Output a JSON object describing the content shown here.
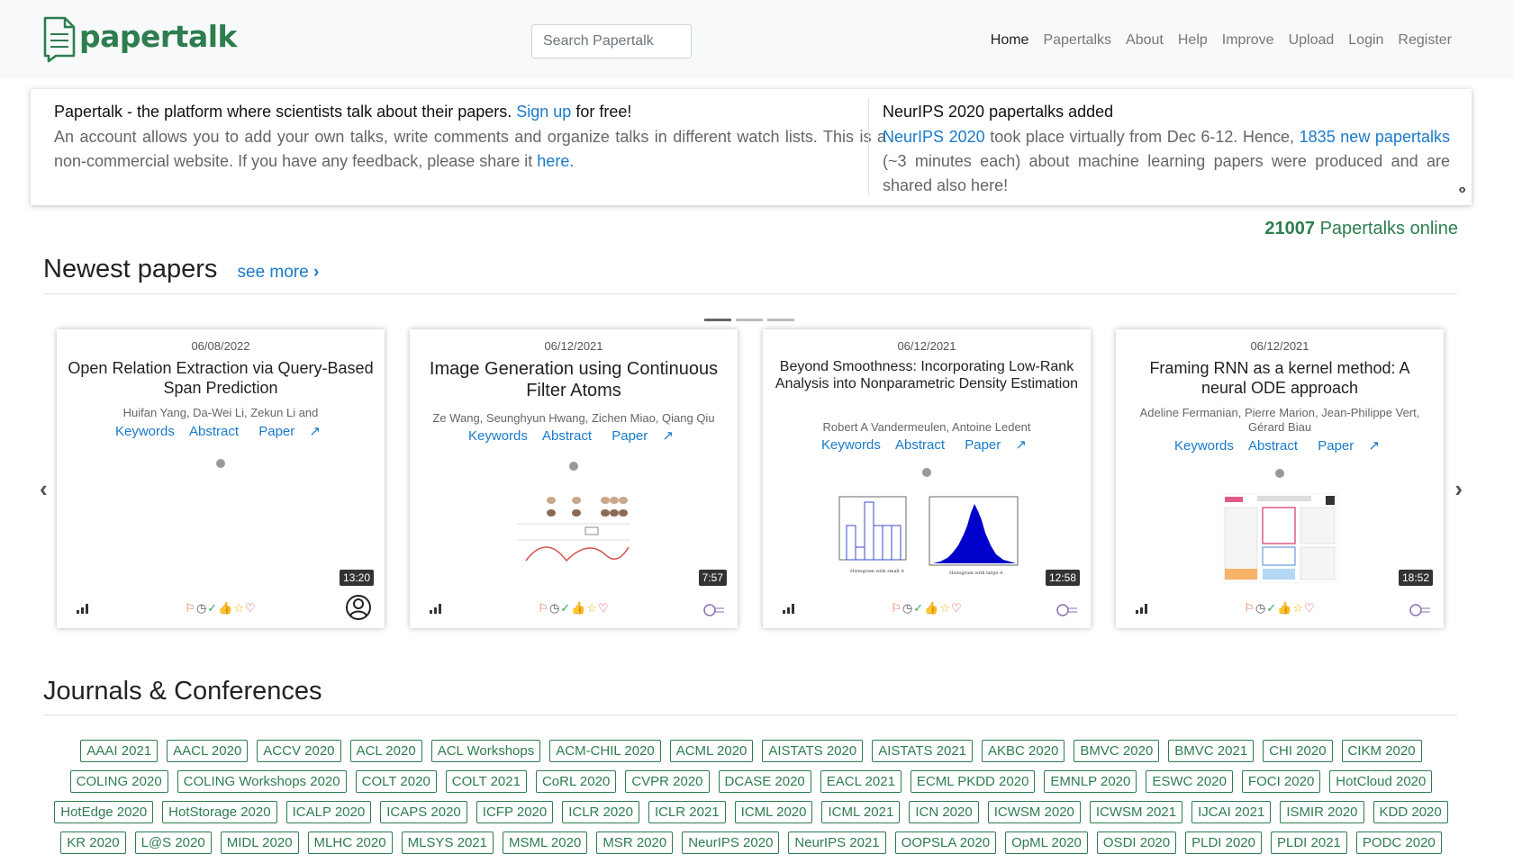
{
  "header": {
    "brand": "papertalk",
    "search_placeholder": "Search Papertalk",
    "nav": [
      "Home",
      "Papertalks",
      "About",
      "Help",
      "Improve",
      "Upload",
      "Login",
      "Register"
    ]
  },
  "info": {
    "left_title_pre": "Papertalk - the platform where scientists talk about their papers.",
    "left_title_link": "Sign up",
    "left_title_post": "for free!",
    "left_body": "An account allows you to add your own talks, write comments and organize talks in different watch lists. This is a non-commercial website. If you have any feedback, please share it",
    "left_body_link": "here.",
    "right_title": "NeurIPS 2020 papertalks added",
    "right_link1": "NeurIPS 2020",
    "right_mid": "took place virtually from Dec 6-12. Hence,",
    "right_link2": "1835 new papertalks",
    "right_end": "(~3 minutes each) about machine learning papers were produced and are shared also here!",
    "arrows": "‹›"
  },
  "online": {
    "count": "21007",
    "label": "Papertalks online"
  },
  "newest": {
    "title": "Newest papers",
    "see_more": "see more"
  },
  "cards": [
    {
      "date": "06/08/2022",
      "title": "Open Relation Extraction via Query-Based Span Prediction",
      "authors": "Huifan Yang, Da-Wei Li, Zekun Li and",
      "keywords": "Keywords",
      "abstract": "Abstract",
      "paper": "Paper",
      "duration": "13:20",
      "actions": [
        "⚐",
        "◷",
        "✓",
        "👍",
        "☆",
        "♡"
      ]
    },
    {
      "date": "06/12/2021",
      "title": "Image Generation using Continuous Filter Atoms",
      "authors": "Ze Wang, Seunghyun Hwang, Zichen Miao, Qiang Qiu",
      "keywords": "Keywords",
      "abstract": "Abstract",
      "paper": "Paper",
      "duration": "7:57",
      "actions": [
        "⚐",
        "◷",
        "✓",
        "👍",
        "☆",
        "♡"
      ]
    },
    {
      "date": "06/12/2021",
      "title": "Beyond Smoothness: Incorporating Low-Rank Analysis into Nonparametric Density Estimation",
      "authors": "Robert A Vandermeulen, Antoine Ledent",
      "keywords": "Keywords",
      "abstract": "Abstract",
      "paper": "Paper",
      "duration": "12:58",
      "actions": [
        "⚐",
        "◷",
        "✓",
        "👍",
        "☆",
        "♡"
      ]
    },
    {
      "date": "06/12/2021",
      "title": "Framing RNN as a kernel method: A neural ODE approach",
      "authors": "Adeline Fermanian, Pierre Marion, Jean-Philippe Vert, Gérard Biau",
      "keywords": "Keywords",
      "abstract": "Abstract",
      "paper": "Paper",
      "duration": "18:52",
      "actions": [
        "⚐",
        "◷",
        "✓",
        "👍",
        "☆",
        "♡"
      ]
    }
  ],
  "journals": {
    "title": "Journals & Conferences",
    "rows": [
      [
        "AAAI 2021",
        "AACL 2020",
        "ACCV 2020",
        "ACL 2020",
        "ACL Workshops",
        "ACM-CHIL 2020",
        "ACML 2020",
        "AISTATS 2020",
        "AISTATS 2021",
        "AKBC 2020",
        "BMVC 2020",
        "BMVC 2021",
        "CHI 2020",
        "CIKM 2020"
      ],
      [
        "COLING 2020",
        "COLING Workshops 2020",
        "COLT 2020",
        "COLT 2021",
        "CoRL 2020",
        "CVPR 2020",
        "DCASE 2020",
        "EACL 2021",
        "ECML PKDD 2020",
        "EMNLP 2020",
        "ESWC 2020",
        "FOCI 2020",
        "HotCloud 2020"
      ],
      [
        "HotEdge 2020",
        "HotStorage 2020",
        "ICALP 2020",
        "ICAPS 2020",
        "ICFP 2020",
        "ICLR 2020",
        "ICLR 2021",
        "ICML 2020",
        "ICML 2021",
        "ICN 2020",
        "ICWSM 2020",
        "ICWSM 2021",
        "IJCAI 2021",
        "ISMIR 2020",
        "KDD 2020"
      ],
      [
        "KR 2020",
        "L@S 2020",
        "MIDL 2020",
        "MLHC 2020",
        "MLSYS 2021",
        "MSML 2020",
        "MSR 2020",
        "NeurIPS 2020",
        "NeurIPS 2021",
        "OOPSLA 2020",
        "OpML 2020",
        "OSDI 2020",
        "PLDI 2020",
        "PLDI 2021",
        "PODC 2020"
      ]
    ]
  }
}
